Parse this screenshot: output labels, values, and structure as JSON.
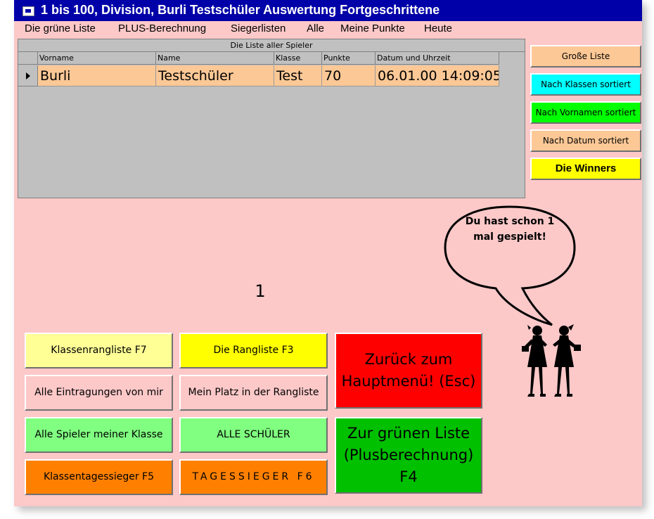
{
  "window": {
    "title": "1 bis 100, Division, Burli Testschüler Auswertung Fortgeschrittene"
  },
  "menu": [
    "Die grüne Liste",
    "PLUS-Berechnung",
    "Siegerlisten",
    "Alle",
    "Meine Punkte",
    "Heute"
  ],
  "grid": {
    "caption": "Die Liste aller Spieler",
    "columns": [
      "Vorname",
      "Name",
      "Klasse",
      "Punkte",
      "Datum und Uhrzeit"
    ],
    "rows": [
      [
        "Burli",
        "Testschüler",
        "Test",
        "70",
        "06.01.00 14:09:05"
      ]
    ]
  },
  "side_buttons": [
    {
      "label": "Große Liste",
      "color": "#fcc896"
    },
    {
      "label": "Nach Klassen sortiert",
      "color": "#00ffff"
    },
    {
      "label": "Nach Vornamen sortiert",
      "color": "#00ff00"
    },
    {
      "label": "Nach Datum sortiert",
      "color": "#fcc896"
    },
    {
      "label": "Die Winners",
      "color": "#ffff00"
    }
  ],
  "counter": "1",
  "speech_bubble": "Du hast schon 1\nmal gespielt!",
  "buttons": {
    "klassenrangliste": {
      "label": "Klassenrangliste F7",
      "color": "#ffff96"
    },
    "rangliste": {
      "label": "Die Rangliste  F3",
      "color": "#ffff00"
    },
    "eintragungen": {
      "label": "Alle Eintragungen von mir",
      "color": "#fcc8c8"
    },
    "mein_platz": {
      "label": "Mein Platz in der Rangliste",
      "color": "#fcc8c8"
    },
    "spieler_klasse": {
      "label": "Alle Spieler meiner Klasse",
      "color": "#80ff80"
    },
    "alle_schueler": {
      "label": "ALLE SCHÜLER",
      "color": "#80ff80"
    },
    "klassentagessieger": {
      "label": "Klassentagessieger F5",
      "color": "#ff8000"
    },
    "tagessieger": {
      "label": "TAGESSIEGER  F6",
      "color": "#ff8000"
    },
    "zurueck": {
      "label": "Zurück zum\nHauptmenü!  (Esc)",
      "color": "#ff0000"
    },
    "gruene_liste": {
      "label": "Zur grünen Liste\n(Plusberechnung)\nF4",
      "color": "#00c000"
    }
  },
  "icons": {
    "app": "window-icon",
    "figures": "two-girls-silhouette-icon"
  }
}
